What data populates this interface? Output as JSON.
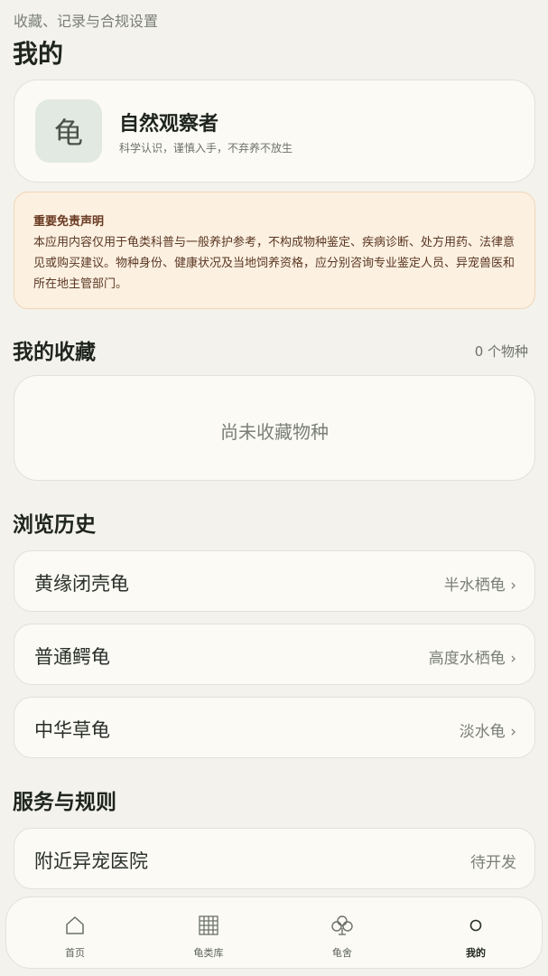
{
  "header": {
    "subtitle": "收藏、记录与合规设置",
    "title": "我的"
  },
  "profile": {
    "avatar_char": "龟",
    "name": "自然观察者",
    "motto": "科学认识，谨慎入手，不弃养不放生"
  },
  "disclaimer": {
    "title": "重要免责声明",
    "body": "本应用内容仅用于龟类科普与一般养护参考，不构成物种鉴定、疾病诊断、处方用药、法律意见或购买建议。物种身份、健康状况及当地饲养资格，应分别咨询专业鉴定人员、异宠兽医和所在地主管部门。"
  },
  "favorites": {
    "title": "我的收藏",
    "count": "0 个物种",
    "empty_text": "尚未收藏物种"
  },
  "history": {
    "title": "浏览历史",
    "items": [
      {
        "name": "黄缘闭壳龟",
        "tag": "半水栖龟 ›"
      },
      {
        "name": "普通鳄龟",
        "tag": "高度水栖龟 ›"
      },
      {
        "name": "中华草龟",
        "tag": "淡水龟 ›"
      }
    ]
  },
  "services": {
    "title": "服务与规则",
    "items": [
      {
        "name": "附近异宠医院",
        "tag": "待开发"
      }
    ]
  },
  "tabbar": {
    "tabs": [
      {
        "label": "首页",
        "icon": "home-icon"
      },
      {
        "label": "龟类库",
        "icon": "grid-icon"
      },
      {
        "label": "龟舍",
        "icon": "turtle-house-icon"
      },
      {
        "label": "我的",
        "icon": "profile-circle-icon"
      }
    ],
    "active": "我的"
  },
  "colors": {
    "background": "#f3f2ec",
    "card": "#fbfaf5",
    "disclaimer_bg": "#fcf0e1",
    "disclaimer_text": "#5a3722",
    "avatar_bg": "#e2e9e2"
  }
}
